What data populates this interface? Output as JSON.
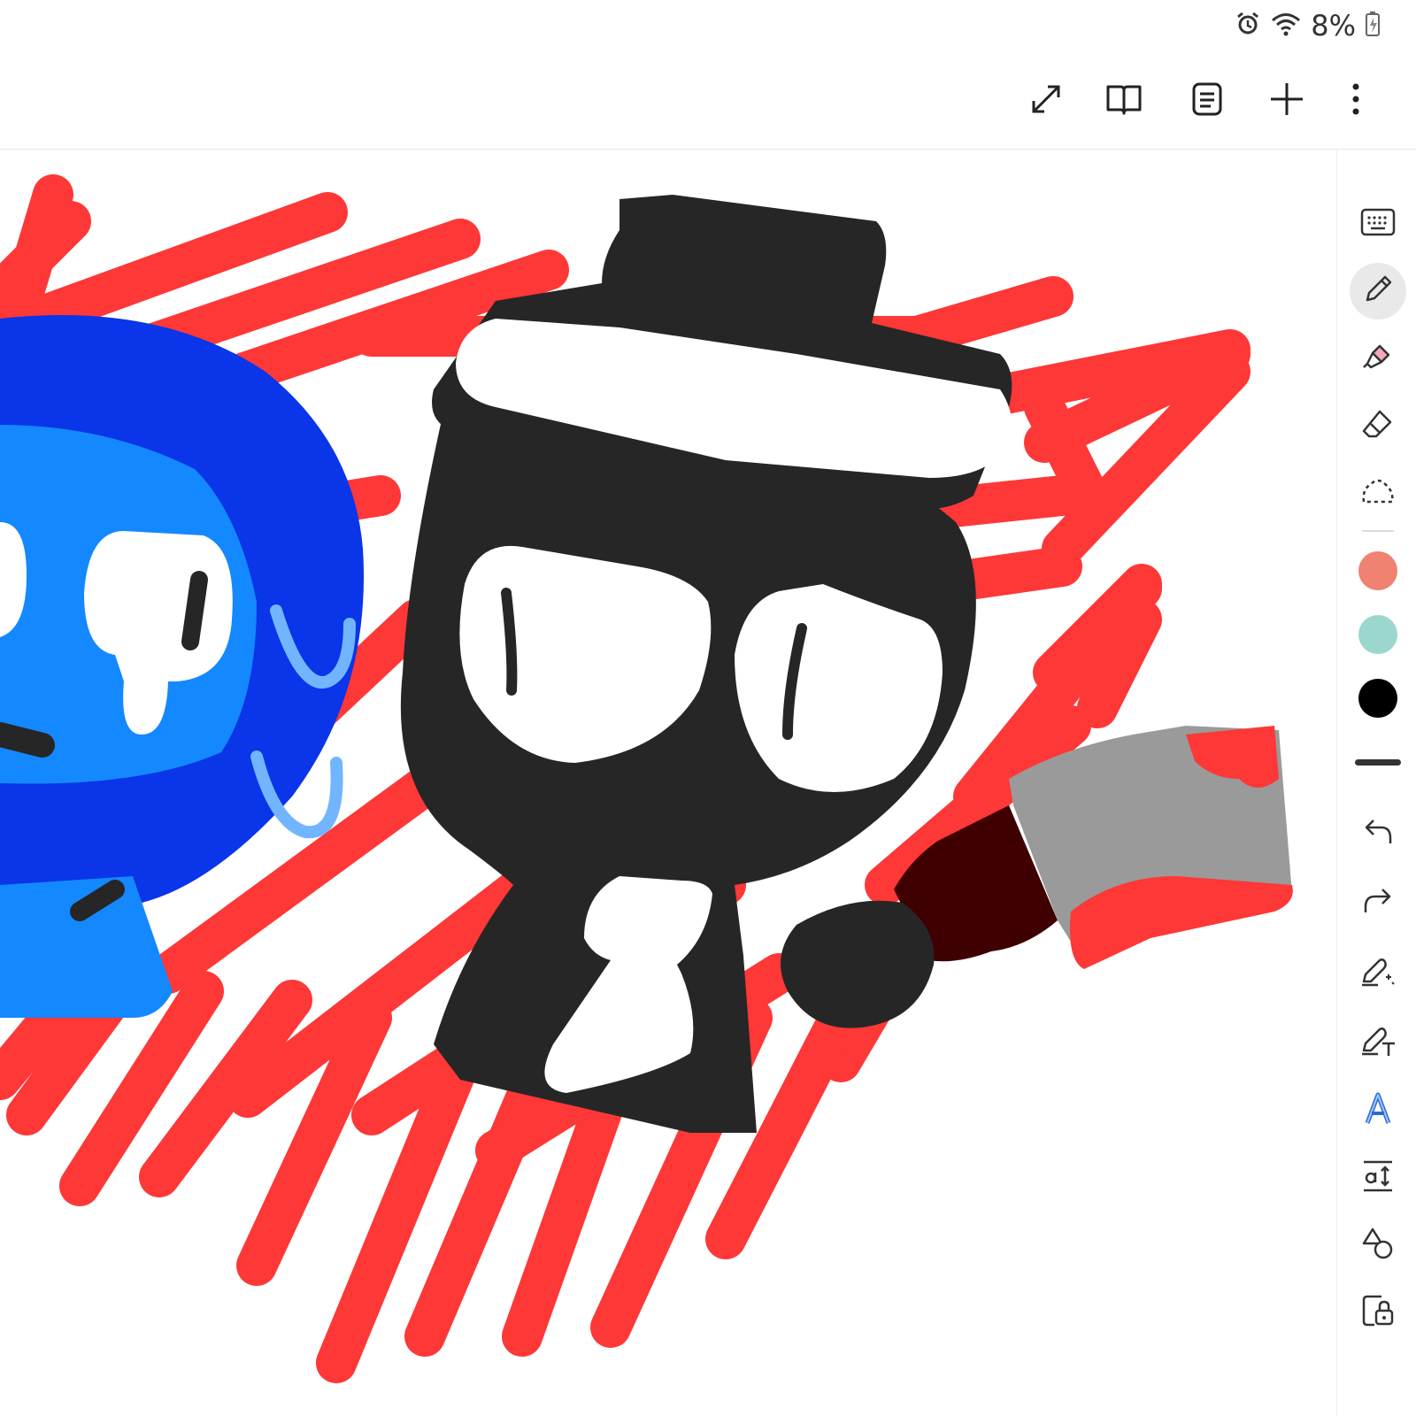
{
  "status": {
    "battery_percent": "8%",
    "icons": [
      "alarm-icon",
      "wifi-icon",
      "battery-charging-icon"
    ]
  },
  "topbar": {
    "buttons": [
      "expand-icon",
      "book-view-icon",
      "page-list-icon",
      "add-icon",
      "more-vert-icon"
    ]
  },
  "toolbar": {
    "tools": [
      "keyboard-icon",
      "pen-icon",
      "highlighter-icon",
      "eraser-icon",
      "lasso-icon"
    ],
    "active_tool": "pen",
    "colors": [
      "#ef8270",
      "#9bd7cc",
      "#000000"
    ],
    "stroke": "thick",
    "actions": [
      "undo-icon",
      "redo-icon",
      "shape-recognition-pen-icon",
      "pen-to-text-icon",
      "text-style-icon",
      "text-size-icon",
      "shapes-icon",
      "lock-icon"
    ]
  },
  "colors": {
    "splatter_red": "#fe3737",
    "blue_dark": "#0a35e8",
    "blue_light": "#1488ff",
    "blue_pale": "#72b5ff",
    "ink_black": "#262626",
    "axe_gray": "#9a9a9a",
    "axe_handle": "#3e0000"
  }
}
